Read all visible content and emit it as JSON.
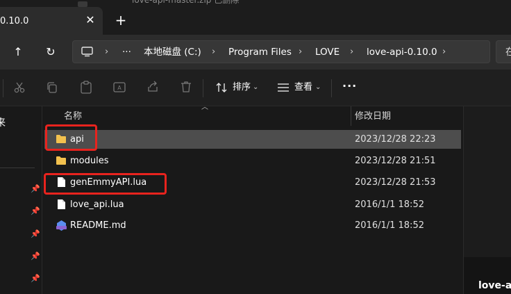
{
  "top_strip": {
    "text": "love-api-master.zip   已删除"
  },
  "tab": {
    "title": "0.10.0",
    "close": "✕",
    "new_tab": "+"
  },
  "nav": {
    "up": "↑",
    "refresh": "↻"
  },
  "address": {
    "more": "···",
    "crumbs": [
      "本地磁盘 (C:)",
      "Program Files",
      "LOVE",
      "love-api-0.10.0"
    ],
    "separator": "›"
  },
  "search": {
    "text": "在"
  },
  "toolbar": {
    "sort_label": "排序",
    "view_label": "查看",
    "more": "···"
  },
  "sidebar": {
    "partial_text": "来"
  },
  "columns": {
    "name": "名称",
    "modified": "修改日期"
  },
  "files": [
    {
      "name": "api",
      "date": "2023/12/28 22:23",
      "type": "folder"
    },
    {
      "name": "modules",
      "date": "2023/12/28 21:51",
      "type": "folder"
    },
    {
      "name": "genEmmyAPI.lua",
      "date": "2023/12/28 21:53",
      "type": "file"
    },
    {
      "name": "love_api.lua",
      "date": "2016/1/1 18:52",
      "type": "file"
    },
    {
      "name": "README.md",
      "date": "2016/1/1 18:52",
      "type": "markdown"
    }
  ],
  "preview": {
    "name": "love-api"
  },
  "colors": {
    "highlight": "#e8231e",
    "folder": "#f2c14e",
    "selected_row": "#4d4d4d"
  }
}
